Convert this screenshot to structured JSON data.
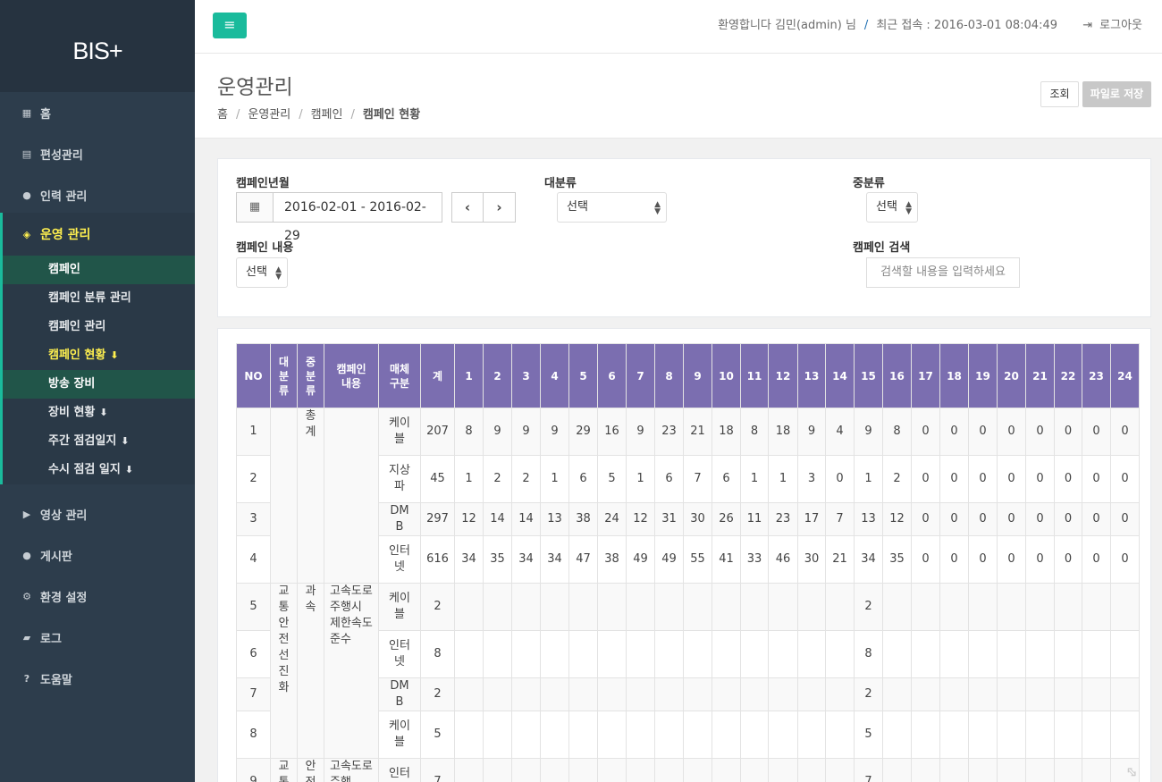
{
  "app": {
    "logo": "BIS+"
  },
  "sidebar": {
    "items": [
      {
        "label": "홈",
        "icon": "grid-icon"
      },
      {
        "label": "편성관리",
        "icon": "calendar-icon"
      },
      {
        "label": "인력 관리",
        "icon": "users-icon"
      }
    ],
    "active_group": {
      "label": "운영 관리",
      "icon": "cube-icon",
      "subitems": [
        {
          "label": "캠페인"
        },
        {
          "label": "캠페인 분류 관리"
        },
        {
          "label": "캠페인 관리"
        },
        {
          "label": "캠페인 현황"
        },
        {
          "label": "방송 장비"
        },
        {
          "label": "장비 현황"
        },
        {
          "label": "주간 점검일지"
        },
        {
          "label": "수시 점검 일지"
        }
      ]
    },
    "items_after": [
      {
        "label": "영상 관리",
        "icon": "video-icon"
      },
      {
        "label": "게시판",
        "icon": "comment-icon"
      },
      {
        "label": "환경 설정",
        "icon": "cogs-icon"
      },
      {
        "label": "로그",
        "icon": "book-icon"
      },
      {
        "label": "도움말",
        "icon": "question-icon"
      }
    ]
  },
  "topbar": {
    "welcome": "환영합니다 김민(admin) 님",
    "separator": "/",
    "last_access": "최근 접속 : 2016-03-01 08:04:49",
    "logout": "로그아웃"
  },
  "page": {
    "title": "운영관리",
    "breadcrumb": [
      "홈",
      "운영관리",
      "캠페인",
      "캠페인 현황"
    ],
    "search_button": "조회",
    "save_button": "파일로 저장"
  },
  "filters": {
    "period_label": "캠페인년월",
    "period_value": "2016-02-01 - 2016-02-29",
    "major_label": "대분류",
    "major_value": "선택",
    "middle_label": "중분류",
    "middle_value": "선택",
    "content_label": "캠페인 내용",
    "content_value": "선택",
    "search_label": "캠페인 검색",
    "search_placeholder": "검색할 내용을 입력하세요"
  },
  "table": {
    "headers": [
      "NO",
      "대분류",
      "중분류",
      "캠페인 내용",
      "매체 구분",
      "계",
      "1",
      "2",
      "3",
      "4",
      "5",
      "6",
      "7",
      "8",
      "9",
      "10",
      "11",
      "12",
      "13",
      "14",
      "15",
      "16",
      "17",
      "18",
      "19",
      "20",
      "21",
      "22",
      "23",
      "24"
    ],
    "groups": [
      {
        "major": "",
        "middle": "총계",
        "content": ""
      },
      {
        "major": "교통안전선진화",
        "middle": "과속",
        "content": "고속도로 주행시 제한속도 준수"
      },
      {
        "major": "교통",
        "middle": "안전",
        "content": "고속도로 주행"
      }
    ],
    "rows": [
      {
        "no": "1",
        "media": "케이블",
        "total": "207",
        "days": [
          "8",
          "9",
          "9",
          "9",
          "29",
          "16",
          "9",
          "23",
          "21",
          "18",
          "8",
          "18",
          "9",
          "4",
          "9",
          "8",
          "0",
          "0",
          "0",
          "0",
          "0",
          "0",
          "0",
          "0"
        ]
      },
      {
        "no": "2",
        "media": "지상파",
        "total": "45",
        "days": [
          "1",
          "2",
          "2",
          "1",
          "6",
          "5",
          "1",
          "6",
          "7",
          "6",
          "1",
          "1",
          "3",
          "0",
          "1",
          "2",
          "0",
          "0",
          "0",
          "0",
          "0",
          "0",
          "0",
          "0"
        ]
      },
      {
        "no": "3",
        "media": "DMB",
        "total": "297",
        "days": [
          "12",
          "14",
          "14",
          "13",
          "38",
          "24",
          "12",
          "31",
          "30",
          "26",
          "11",
          "23",
          "17",
          "7",
          "13",
          "12",
          "0",
          "0",
          "0",
          "0",
          "0",
          "0",
          "0",
          "0"
        ]
      },
      {
        "no": "4",
        "media": "인터넷",
        "total": "616",
        "days": [
          "34",
          "35",
          "34",
          "34",
          "47",
          "38",
          "49",
          "49",
          "55",
          "41",
          "33",
          "46",
          "30",
          "21",
          "34",
          "35",
          "0",
          "0",
          "0",
          "0",
          "0",
          "0",
          "0",
          "0"
        ]
      },
      {
        "no": "5",
        "media": "케이블",
        "total": "2",
        "days": [
          "",
          "",
          "",
          "",
          "",
          "",
          "",
          "",
          "",
          "",
          "",
          "",
          "",
          "",
          "2",
          "",
          "",
          "",
          "",
          "",
          "",
          "",
          "",
          ""
        ]
      },
      {
        "no": "6",
        "media": "인터넷",
        "total": "8",
        "days": [
          "",
          "",
          "",
          "",
          "",
          "",
          "",
          "",
          "",
          "",
          "",
          "",
          "",
          "",
          "8",
          "",
          "",
          "",
          "",
          "",
          "",
          "",
          "",
          ""
        ]
      },
      {
        "no": "7",
        "media": "DMB",
        "total": "2",
        "days": [
          "",
          "",
          "",
          "",
          "",
          "",
          "",
          "",
          "",
          "",
          "",
          "",
          "",
          "",
          "2",
          "",
          "",
          "",
          "",
          "",
          "",
          "",
          "",
          ""
        ]
      },
      {
        "no": "8",
        "media": "케이블",
        "total": "5",
        "days": [
          "",
          "",
          "",
          "",
          "",
          "",
          "",
          "",
          "",
          "",
          "",
          "",
          "",
          "",
          "5",
          "",
          "",
          "",
          "",
          "",
          "",
          "",
          "",
          ""
        ]
      },
      {
        "no": "9",
        "media": "인터넷",
        "total": "7",
        "days": [
          "",
          "",
          "",
          "",
          "",
          "",
          "",
          "",
          "",
          "",
          "",
          "",
          "",
          "",
          "7",
          "",
          "",
          "",
          "",
          "",
          "",
          "",
          "",
          ""
        ]
      }
    ]
  },
  "colors": {
    "accent": "#1abb9c",
    "sidebar": "#2d3d4c",
    "table_header": "#7b6eb0",
    "highlight": "#fff04f"
  }
}
